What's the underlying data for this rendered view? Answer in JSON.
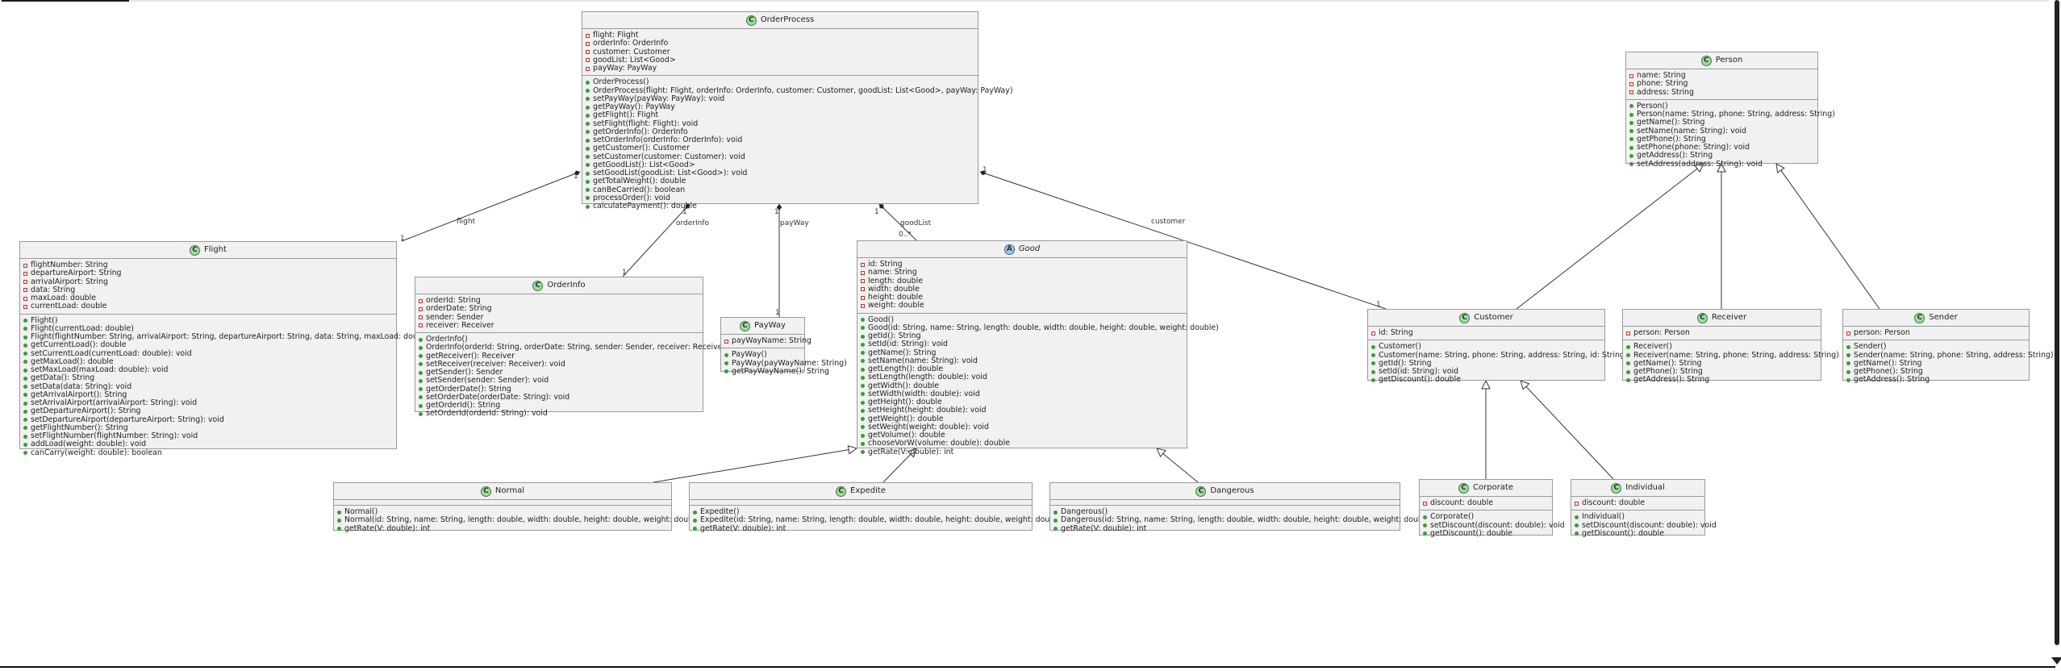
{
  "diagram": {
    "classes": [
      {
        "key": "orderprocess",
        "name": "OrderProcess",
        "stereotype": "C",
        "fields": [
          "flight: Flight",
          "orderInfo: OrderInfo",
          "customer: Customer",
          "goodList: List<Good>",
          "payWay: PayWay"
        ],
        "methods": [
          "OrderProcess()",
          "OrderProcess(flight: Flight, orderInfo: OrderInfo, customer: Customer, goodList: List<Good>, payWay: PayWay)",
          "setPayWay(payWay: PayWay): void",
          "getPayWay(): PayWay",
          "getFlight(): Flight",
          "setFlight(flight: Flight): void",
          "getOrderInfo(): OrderInfo",
          "setOrderInfo(orderInfo: OrderInfo): void",
          "getCustomer(): Customer",
          "setCustomer(customer: Customer): void",
          "getGoodList(): List<Good>",
          "setGoodList(goodList: List<Good>): void",
          "getTotalWeight(): double",
          "canBeCarried(): boolean",
          "processOrder(): void",
          "calculatePayment(): double"
        ]
      },
      {
        "key": "flight",
        "name": "Flight",
        "stereotype": "C",
        "fields": [
          "flightNumber: String",
          "departureAirport: String",
          "arrivalAirport: String",
          "data: String",
          "maxLoad: double",
          "currentLoad: double"
        ],
        "methods": [
          "Flight()",
          "Flight(currentLoad: double)",
          "Flight(flightNumber: String, arrivalAirport: String, departureAirport: String, data: String, maxLoad: double)",
          "getCurrentLoad(): double",
          "setCurrentLoad(currentLoad: double): void",
          "getMaxLoad(): double",
          "setMaxLoad(maxLoad: double): void",
          "getData(): String",
          "setData(data: String): void",
          "getArrivalAirport(): String",
          "setArrivalAirport(arrivalAirport: String): void",
          "getDepartureAirport(): String",
          "setDepartureAirport(departureAirport: String): void",
          "getFlightNumber(): String",
          "setFlightNumber(flightNumber: String): void",
          "addLoad(weight: double): void",
          "canCarry(weight: double): boolean"
        ]
      },
      {
        "key": "orderinfo",
        "name": "OrderInfo",
        "stereotype": "C",
        "fields": [
          "orderId: String",
          "orderDate: String",
          "sender: Sender",
          "receiver: Receiver"
        ],
        "methods": [
          "OrderInfo()",
          "OrderInfo(orderId: String, orderDate: String, sender: Sender, receiver: Receiver)",
          "getReceiver(): Receiver",
          "setReceiver(receiver: Receiver): void",
          "getSender(): Sender",
          "setSender(sender: Sender): void",
          "getOrderDate(): String",
          "setOrderDate(orderDate: String): void",
          "getOrderId(): String",
          "setOrderId(orderId: String): void"
        ]
      },
      {
        "key": "payway",
        "name": "PayWay",
        "stereotype": "C",
        "fields": [
          "payWayName: String"
        ],
        "methods": [
          "PayWay()",
          "PayWay(payWayName: String)",
          "getPayWayName(): String"
        ]
      },
      {
        "key": "good",
        "name": "Good",
        "stereotype": "A",
        "fields": [
          "id: String",
          "name: String",
          "length: double",
          "width: double",
          "height: double",
          "weight: double"
        ],
        "methods": [
          "Good()",
          "Good(id: String, name: String, length: double, width: double, height: double, weight: double)",
          "getId(): String",
          "setId(id: String): void",
          "getName(): String",
          "setName(name: String): void",
          "getLength(): double",
          "setLength(length: double): void",
          "getWidth(): double",
          "setWidth(width: double): void",
          "getHeight(): double",
          "setHeight(height: double): void",
          "getWeight(): double",
          "setWeight(weight: double): void",
          "getVolume(): double",
          "chooseVorW(volume: double): double",
          "getRate(V: double): int"
        ]
      },
      {
        "key": "normal",
        "name": "Normal",
        "stereotype": "C",
        "fields": [],
        "methods": [
          "Normal()",
          "Normal(id: String, name: String, length: double, width: double, height: double, weight: double)",
          "getRate(V: double): int"
        ]
      },
      {
        "key": "expedite",
        "name": "Expedite",
        "stereotype": "C",
        "fields": [],
        "methods": [
          "Expedite()",
          "Expedite(id: String, name: String, length: double, width: double, height: double, weight: double)",
          "getRate(V: double): int"
        ]
      },
      {
        "key": "dangerous",
        "name": "Dangerous",
        "stereotype": "C",
        "fields": [],
        "methods": [
          "Dangerous()",
          "Dangerous(id: String, name: String, length: double, width: double, height: double, weight: double)",
          "getRate(V: double): int"
        ]
      },
      {
        "key": "person",
        "name": "Person",
        "stereotype": "C",
        "fields": [
          "name: String",
          "phone: String",
          "address: String"
        ],
        "methods": [
          "Person()",
          "Person(name: String, phone: String, address: String)",
          "getName(): String",
          "setName(name: String): void",
          "getPhone(): String",
          "setPhone(phone: String): void",
          "getAddress(): String",
          "setAddress(address: String): void"
        ]
      },
      {
        "key": "customer",
        "name": "Customer",
        "stereotype": "C",
        "fields": [
          "id: String"
        ],
        "methods": [
          "Customer()",
          "Customer(name: String, phone: String, address: String, id: String)",
          "getId(): String",
          "setId(id: String): void",
          "getDiscount(): double"
        ]
      },
      {
        "key": "receiver",
        "name": "Receiver",
        "stereotype": "C",
        "fields": [
          "person: Person"
        ],
        "methods": [
          "Receiver()",
          "Receiver(name: String, phone: String, address: String)",
          "getName(): String",
          "getPhone(): String",
          "getAddress(): String"
        ]
      },
      {
        "key": "sender",
        "name": "Sender",
        "stereotype": "C",
        "fields": [
          "person: Person"
        ],
        "methods": [
          "Sender()",
          "Sender(name: String, phone: String, address: String)",
          "getName(): String",
          "getPhone(): String",
          "getAddress(): String"
        ]
      },
      {
        "key": "corporate",
        "name": "Corporate",
        "stereotype": "C",
        "fields": [
          "discount: double"
        ],
        "methods": [
          "Corporate()",
          "setDiscount(discount: double): void",
          "getDiscount(): double"
        ]
      },
      {
        "key": "individual",
        "name": "Individual",
        "stereotype": "C",
        "fields": [
          "discount: double"
        ],
        "methods": [
          "Individual()",
          "setDiscount(discount: double): void",
          "getDiscount(): double"
        ]
      }
    ],
    "associations": [
      {
        "key": "flight",
        "from": "orderprocess",
        "to": "flight",
        "label": "flight",
        "from_mult": "1",
        "to_mult": "1"
      },
      {
        "key": "orderinfo",
        "from": "orderprocess",
        "to": "orderinfo",
        "label": "orderInfo",
        "from_mult": "1",
        "to_mult": "1"
      },
      {
        "key": "payway",
        "from": "orderprocess",
        "to": "payway",
        "label": "payWay",
        "from_mult": "1",
        "to_mult": "1"
      },
      {
        "key": "goodlist",
        "from": "orderprocess",
        "to": "good",
        "label": "goodList",
        "from_mult": "1",
        "to_mult": "0..*"
      },
      {
        "key": "customer",
        "from": "orderprocess",
        "to": "customer",
        "label": "customer",
        "from_mult": "1",
        "to_mult": "1"
      }
    ],
    "generalizations": [
      {
        "child": "normal",
        "parent": "good"
      },
      {
        "child": "expedite",
        "parent": "good"
      },
      {
        "child": "dangerous",
        "parent": "good"
      },
      {
        "child": "customer",
        "parent": "person"
      },
      {
        "child": "receiver",
        "parent": "person"
      },
      {
        "child": "sender",
        "parent": "person"
      },
      {
        "child": "corporate",
        "parent": "customer"
      },
      {
        "child": "individual",
        "parent": "customer"
      }
    ]
  }
}
